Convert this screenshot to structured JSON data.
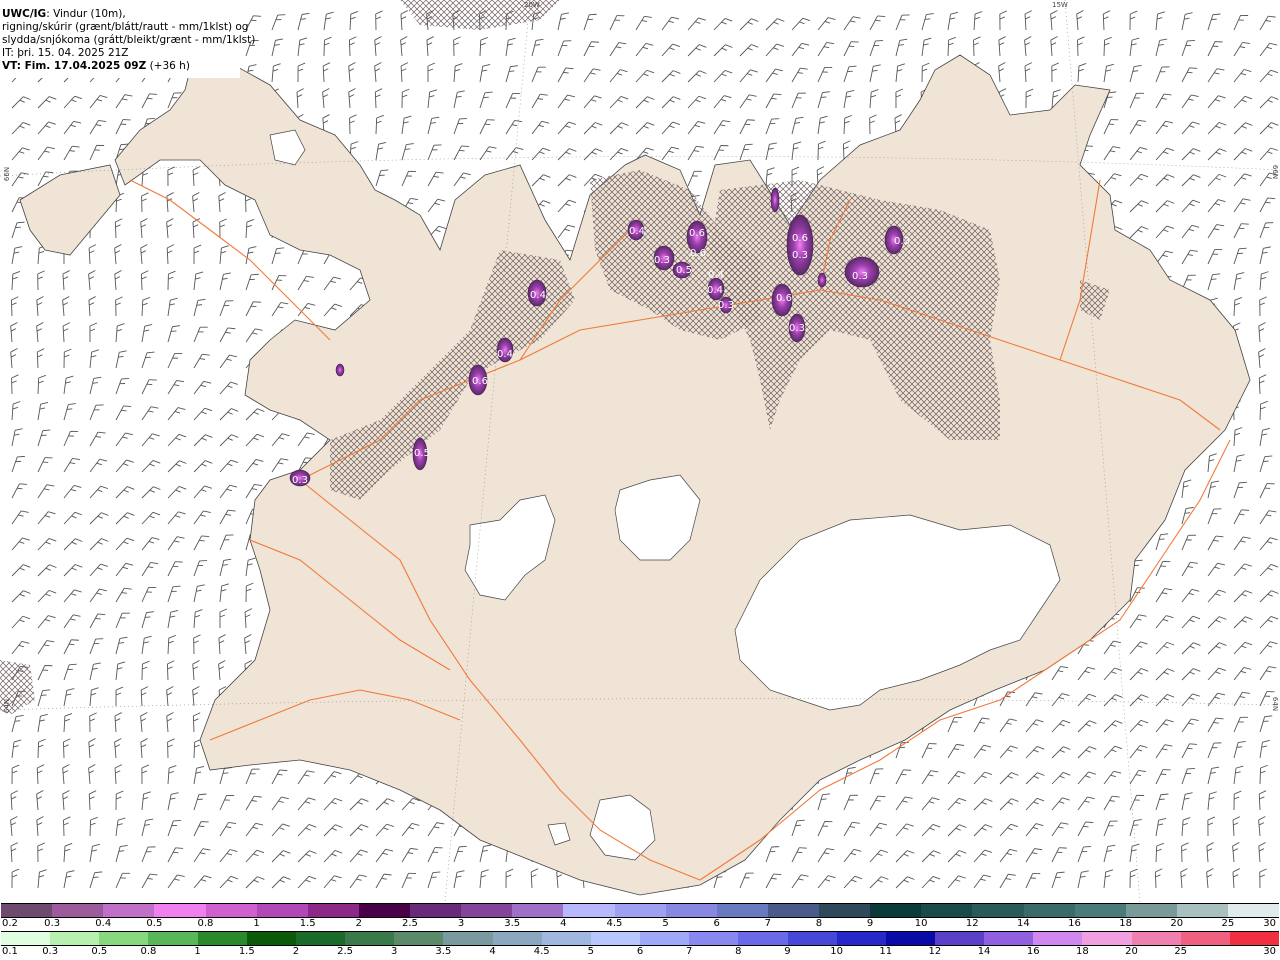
{
  "header": {
    "model": "UWC/IG",
    "line1_rest": ": Vindur (10m),",
    "line2": "rigning/skúrir (grænt/blátt/rautt - mm/1klst) og",
    "line3": "slydda/snjókoma (grátt/bleikt/grænt - mm/1klst)",
    "line4": "IT: þri. 15. 04. 2025 21Z",
    "line5_bold": "VT: Fim. 17.04.2025 09Z",
    "line5_rest": " (+36 h)"
  },
  "grid_labels": {
    "lon_20w": "20W",
    "lon_15w": "15W",
    "lat_66n_left": "66N",
    "lat_66n_right": "66N",
    "lat_64n_left": "64N",
    "lat_64n_right": "64N"
  },
  "precip_labels": [
    "0.4",
    "0.6",
    "0.3",
    "0.5",
    "0.4",
    "0.6",
    "0.3",
    "0.4",
    "0.6",
    "0.4",
    "0.6",
    "0.3",
    "0.5",
    "0.3",
    "0.6",
    "0.4",
    "0.3",
    "0.3",
    "0.3"
  ],
  "colors": {
    "land": "#f0e4d6",
    "roads": "#f07a3a",
    "glacier": "#ffffff",
    "sleet_purple": "#6b3a78",
    "hatch": "#7a6a6a"
  },
  "legend": {
    "snow_scale": {
      "colors": [
        "#6e4a6e",
        "#9c5c9c",
        "#c070c8",
        "#f080f0",
        "#d060d0",
        "#b048b8",
        "#8c2888",
        "#4a0048",
        "#6a2a7a",
        "#84449a",
        "#a070c8",
        "#b8b8ff",
        "#a0a0f0",
        "#8888e0",
        "#6a7ac0",
        "#4a5a8a",
        "#2e4a5a",
        "#0a3a3a",
        "#1a4a4a",
        "#2a5a5a",
        "#3a6a6a",
        "#4a7a7a",
        "#7a9a9a",
        "#a8c0c0",
        "#e0ecec"
      ],
      "ticks": [
        "0.2",
        "0.3",
        "0.4",
        "0.5",
        "0.8",
        "1",
        "1.5",
        "2",
        "2.5",
        "3",
        "3.5",
        "4",
        "4.5",
        "5",
        "6",
        "7",
        "8",
        "9",
        "10",
        "12",
        "14",
        "16",
        "18",
        "20",
        "25",
        "30"
      ]
    },
    "rain_scale": {
      "colors": [
        "#e0ffe0",
        "#b8f0b0",
        "#88d880",
        "#58b858",
        "#2a8a2a",
        "#0a5a0a",
        "#1a6a2a",
        "#3a7a4a",
        "#5a8a6a",
        "#7a9aa0",
        "#8aa8c0",
        "#a0b8e0",
        "#b8c8ff",
        "#a0a8f8",
        "#8888f0",
        "#6a6ae8",
        "#4848d8",
        "#2828c8",
        "#0a0aa8",
        "#5a40c8",
        "#9060e0",
        "#d088f0",
        "#f0a0e0",
        "#f080b0",
        "#f06080",
        "#f03040"
      ],
      "ticks": [
        "0.1",
        "0.3",
        "0.5",
        "0.8",
        "1",
        "1.5",
        "2",
        "2.5",
        "3",
        "3.5",
        "4",
        "4.5",
        "5",
        "6",
        "7",
        "8",
        "9",
        "10",
        "11",
        "12",
        "14",
        "16",
        "18",
        "20",
        "25",
        "30"
      ]
    }
  }
}
